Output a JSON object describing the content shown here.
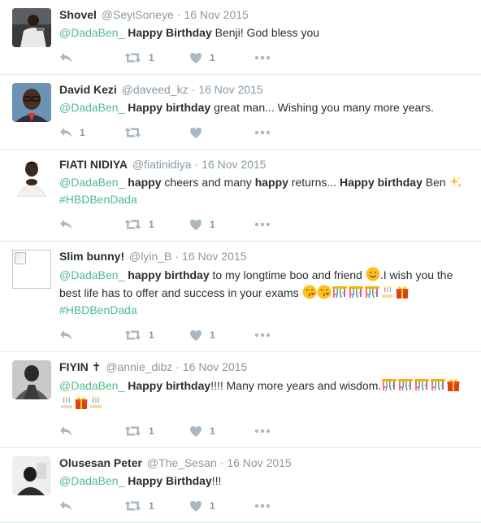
{
  "tweets": [
    {
      "name": "Shovel",
      "handle": "@SeyiSoneye",
      "date": "16 Nov 2015",
      "avatar": "photo",
      "segments": [
        {
          "t": "@DadaBen_",
          "k": "mention"
        },
        {
          "t": " ",
          "k": "plain"
        },
        {
          "t": "Happy Birthday",
          "k": "bold"
        },
        {
          "t": " Benji! God bless you",
          "k": "plain"
        }
      ],
      "counts": {
        "reply": "",
        "retweet": "1",
        "like": "1"
      }
    },
    {
      "name": "David Kezi",
      "handle": "@daveed_kz",
      "date": "16 Nov 2015",
      "avatar": "photo",
      "segments": [
        {
          "t": "@DadaBen_",
          "k": "mention"
        },
        {
          "t": " ",
          "k": "plain"
        },
        {
          "t": "Happy birthday",
          "k": "bold"
        },
        {
          "t": " great man...  Wishing you many more years.",
          "k": "plain"
        }
      ],
      "counts": {
        "reply": "1",
        "retweet": "",
        "like": ""
      }
    },
    {
      "name": "FIATI NIDIYA",
      "handle": "@fiatinidiya",
      "date": "16 Nov 2015",
      "avatar": "photo",
      "segments": [
        {
          "t": "@DadaBen_",
          "k": "mention"
        },
        {
          "t": " ",
          "k": "plain"
        },
        {
          "t": "happy",
          "k": "bold"
        },
        {
          "t": " cheers and many ",
          "k": "plain"
        },
        {
          "t": "happy",
          "k": "bold"
        },
        {
          "t": " returns... ",
          "k": "plain"
        },
        {
          "t": "Happy birthday",
          "k": "bold"
        },
        {
          "t": " Ben ",
          "k": "plain"
        },
        {
          "t": "sparkles",
          "k": "emoji"
        },
        {
          "t": " ",
          "k": "plain"
        },
        {
          "t": "#HBDBenDada",
          "k": "hashtag"
        }
      ],
      "counts": {
        "reply": "",
        "retweet": "1",
        "like": "1"
      }
    },
    {
      "name": "Slim bunny!",
      "handle": "@lyin_B",
      "date": "16 Nov 2015",
      "avatar": "broken",
      "segments": [
        {
          "t": "@DadaBen_",
          "k": "mention"
        },
        {
          "t": " ",
          "k": "plain"
        },
        {
          "t": "happy birthday",
          "k": "bold"
        },
        {
          "t": " to my longtime boo and friend ",
          "k": "plain"
        },
        {
          "t": "smile",
          "k": "emoji"
        },
        {
          "t": ".I wish you the best life has to offer and success in your exams ",
          "k": "plain"
        },
        {
          "t": "kiss",
          "k": "emoji"
        },
        {
          "t": "kiss",
          "k": "emoji"
        },
        {
          "t": "confetti",
          "k": "emoji"
        },
        {
          "t": "confetti",
          "k": "emoji"
        },
        {
          "t": "confetti",
          "k": "emoji"
        },
        {
          "t": "cake",
          "k": "emoji"
        },
        {
          "t": "gift",
          "k": "emoji"
        },
        {
          "t": " ",
          "k": "plain"
        },
        {
          "t": "#HBDBenDada",
          "k": "hashtag"
        }
      ],
      "counts": {
        "reply": "",
        "retweet": "1",
        "like": "1"
      }
    },
    {
      "name": "FIYIN ✝",
      "handle": "@annie_dibz",
      "date": "16 Nov 2015",
      "avatar": "photo",
      "segments": [
        {
          "t": "@DadaBen_",
          "k": "mention"
        },
        {
          "t": " ",
          "k": "plain"
        },
        {
          "t": "Happy birthday",
          "k": "bold"
        },
        {
          "t": "!!!! Many more years and wisdom.",
          "k": "plain"
        },
        {
          "t": "confetti",
          "k": "emoji"
        },
        {
          "t": "confetti",
          "k": "emoji"
        },
        {
          "t": "confetti",
          "k": "emoji"
        },
        {
          "t": "confetti",
          "k": "emoji"
        },
        {
          "t": "gift",
          "k": "emoji"
        },
        {
          "t": "cake",
          "k": "emoji"
        },
        {
          "t": "gift",
          "k": "emoji"
        },
        {
          "t": "cake",
          "k": "emoji"
        }
      ],
      "counts": {
        "reply": "",
        "retweet": "1",
        "like": "1"
      }
    },
    {
      "name": "Olusesan Peter",
      "handle": "@The_Sesan",
      "date": "16 Nov 2015",
      "avatar": "photo",
      "segments": [
        {
          "t": "@DadaBen_",
          "k": "mention"
        },
        {
          "t": " ",
          "k": "plain"
        },
        {
          "t": "Happy Birthday",
          "k": "bold"
        },
        {
          "t": "!!!",
          "k": "plain"
        }
      ],
      "counts": {
        "reply": "",
        "retweet": "1",
        "like": "1"
      }
    }
  ],
  "colors": {
    "link": "#4fbc8d",
    "muted": "#8899a6",
    "text": "#292f33",
    "border": "#e1e8ed"
  },
  "icons": [
    "reply-icon",
    "retweet-icon",
    "like-icon",
    "more-icon",
    "sparkles-emoji",
    "smile-emoji",
    "kiss-emoji",
    "confetti-emoji",
    "cake-emoji",
    "gift-emoji"
  ]
}
